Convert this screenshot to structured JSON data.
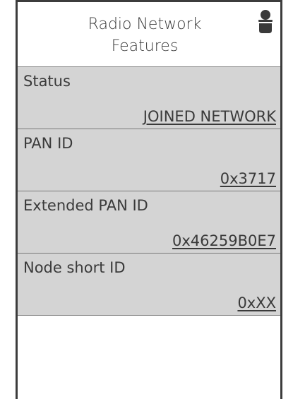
{
  "header": {
    "title_line1": "Radio Network",
    "title_line2": "Features",
    "user_icon": "user-icon"
  },
  "fields": [
    {
      "label": "Status",
      "value": "JOINED NETWORK"
    },
    {
      "label": "PAN ID",
      "value": "0x3717"
    },
    {
      "label": "Extended PAN ID",
      "value": "0x46259B0E7"
    },
    {
      "label": "Node short ID",
      "value": "0xXX"
    }
  ],
  "colors": {
    "frame": "#3c3c3c",
    "field_background": "#d4d4d4",
    "text": "#3a3a3a"
  }
}
